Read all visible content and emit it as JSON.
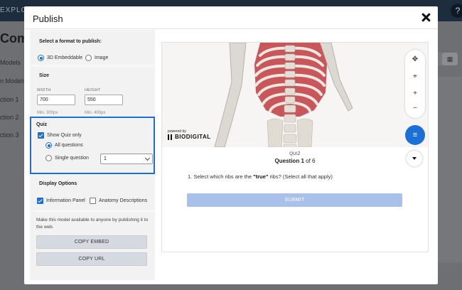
{
  "background": {
    "topbar_label": "EXPLORE",
    "help_icon": "?",
    "page_title": "Comp",
    "nav_items": [
      "Models",
      "n Models",
      "ction 1",
      "ction 2",
      "ction 3"
    ]
  },
  "modal": {
    "title": "Publish",
    "close_icon": "close-icon"
  },
  "format": {
    "label": "Select a format to publish:",
    "options": [
      "3D Embeddable",
      "Image"
    ],
    "selected": "3D Embeddable"
  },
  "size": {
    "label": "Size",
    "width_label": "WIDTH",
    "width_value": "700",
    "width_hint": "Min. 300px",
    "height_label": "HEIGHT",
    "height_value": "550",
    "height_hint": "Min. 400px"
  },
  "quiz": {
    "label": "Quiz",
    "show_quiz_only": "Show Quiz only",
    "show_quiz_only_checked": true,
    "all_questions": "All questions",
    "single_question": "Single question",
    "selected_mode": "All questions",
    "single_question_value": "1"
  },
  "display": {
    "label": "Display Options",
    "info_panel": "Information Panel",
    "info_panel_checked": true,
    "anatomy_desc": "Anatomy Descriptions",
    "anatomy_desc_checked": false
  },
  "publish": {
    "description": "Make this model available to anyone by publishing it to the web.",
    "copy_embed": "COPY EMBED",
    "copy_url": "COPY URL"
  },
  "preview": {
    "powered_by": "powered by",
    "brand": "BIODIGITAL",
    "quiz_tag": "QUIZ",
    "question_prefix": "Question",
    "question_number": "1",
    "question_of": "of 6",
    "question_text_before": "1. Select which ribs are the ",
    "question_text_bold": "\"true\"",
    "question_text_after": " ribs? (Select all that apply)",
    "submit_label": "SUBMIT",
    "accent_color": "#1b6fd6",
    "submit_color": "#a9c1ea"
  }
}
